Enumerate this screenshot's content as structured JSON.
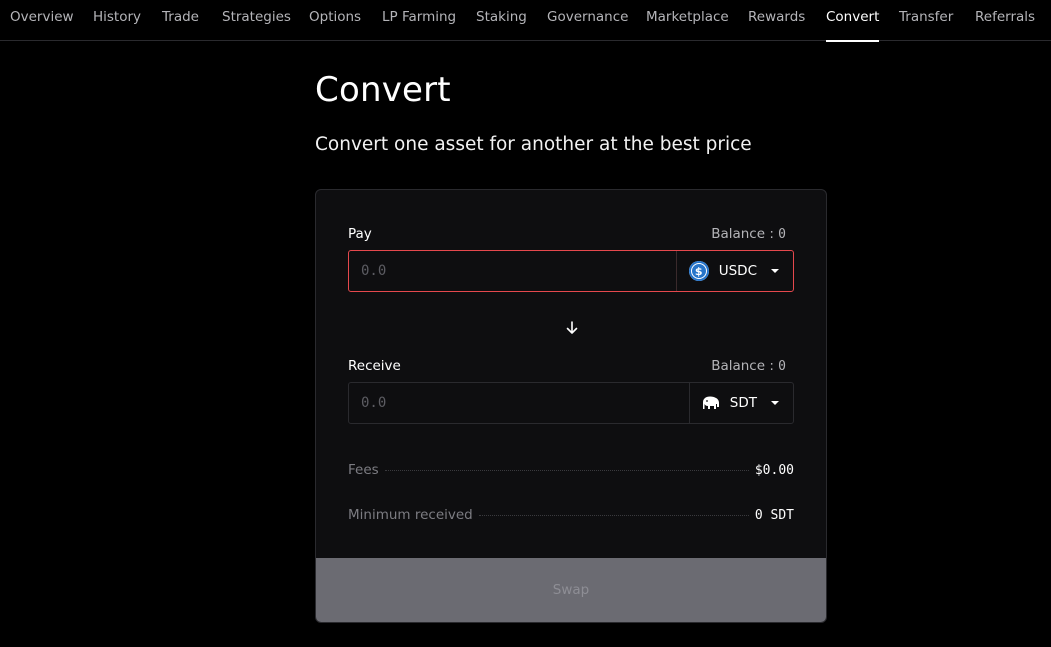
{
  "nav": {
    "items": [
      {
        "label": "Overview"
      },
      {
        "label": "History"
      },
      {
        "label": "Trade"
      },
      {
        "label": "Strategies"
      },
      {
        "label": "Options"
      },
      {
        "label": "LP Farming"
      },
      {
        "label": "Staking"
      },
      {
        "label": "Governance"
      },
      {
        "label": "Marketplace"
      },
      {
        "label": "Rewards"
      },
      {
        "label": "Convert"
      },
      {
        "label": "Transfer"
      },
      {
        "label": "Referrals"
      }
    ],
    "active": "Convert"
  },
  "page": {
    "title": "Convert",
    "subtitle": "Convert one asset for another at the best price"
  },
  "pay": {
    "label": "Pay",
    "balance_label": "Balance : ",
    "balance_value": "0",
    "placeholder": "0.0",
    "token": "USDC",
    "token_icon": "usdc-icon",
    "state": "error"
  },
  "direction_icon": "arrow-down-icon",
  "receive": {
    "label": "Receive",
    "balance_label": "Balance : ",
    "balance_value": "0",
    "placeholder": "0.0",
    "token": "SDT",
    "token_icon": "sdt-elephant-icon"
  },
  "summary": {
    "fees_label": "Fees",
    "fees_value": "$0.00",
    "min_received_label": "Minimum received",
    "min_received_value": "0 SDT"
  },
  "swap_button": {
    "label": "Swap",
    "disabled": true
  },
  "colors": {
    "background": "#000000",
    "card": "#0e0e10",
    "error_border": "#e5484d",
    "usdc_blue": "#2775ca",
    "button_disabled": "#6b6b72"
  }
}
